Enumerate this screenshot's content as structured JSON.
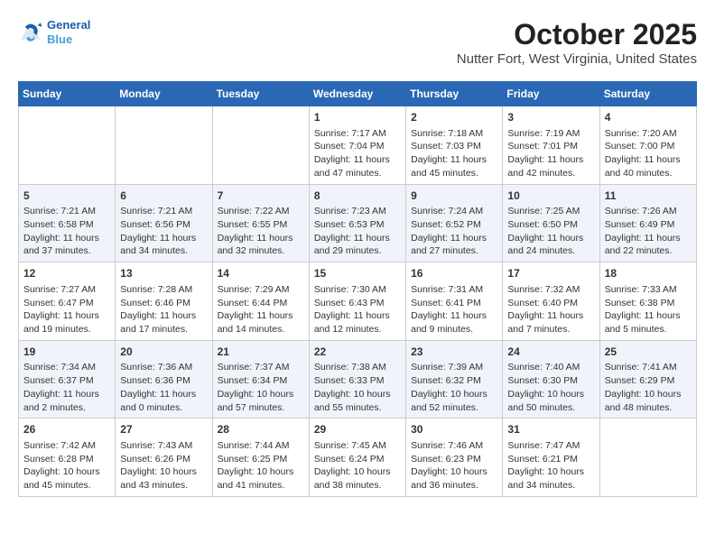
{
  "header": {
    "logo_line1": "General",
    "logo_line2": "Blue",
    "title": "October 2025",
    "subtitle": "Nutter Fort, West Virginia, United States"
  },
  "weekdays": [
    "Sunday",
    "Monday",
    "Tuesday",
    "Wednesday",
    "Thursday",
    "Friday",
    "Saturday"
  ],
  "weeks": [
    [
      {
        "day": "",
        "info": ""
      },
      {
        "day": "",
        "info": ""
      },
      {
        "day": "",
        "info": ""
      },
      {
        "day": "1",
        "info": "Sunrise: 7:17 AM\nSunset: 7:04 PM\nDaylight: 11 hours and 47 minutes."
      },
      {
        "day": "2",
        "info": "Sunrise: 7:18 AM\nSunset: 7:03 PM\nDaylight: 11 hours and 45 minutes."
      },
      {
        "day": "3",
        "info": "Sunrise: 7:19 AM\nSunset: 7:01 PM\nDaylight: 11 hours and 42 minutes."
      },
      {
        "day": "4",
        "info": "Sunrise: 7:20 AM\nSunset: 7:00 PM\nDaylight: 11 hours and 40 minutes."
      }
    ],
    [
      {
        "day": "5",
        "info": "Sunrise: 7:21 AM\nSunset: 6:58 PM\nDaylight: 11 hours and 37 minutes."
      },
      {
        "day": "6",
        "info": "Sunrise: 7:21 AM\nSunset: 6:56 PM\nDaylight: 11 hours and 34 minutes."
      },
      {
        "day": "7",
        "info": "Sunrise: 7:22 AM\nSunset: 6:55 PM\nDaylight: 11 hours and 32 minutes."
      },
      {
        "day": "8",
        "info": "Sunrise: 7:23 AM\nSunset: 6:53 PM\nDaylight: 11 hours and 29 minutes."
      },
      {
        "day": "9",
        "info": "Sunrise: 7:24 AM\nSunset: 6:52 PM\nDaylight: 11 hours and 27 minutes."
      },
      {
        "day": "10",
        "info": "Sunrise: 7:25 AM\nSunset: 6:50 PM\nDaylight: 11 hours and 24 minutes."
      },
      {
        "day": "11",
        "info": "Sunrise: 7:26 AM\nSunset: 6:49 PM\nDaylight: 11 hours and 22 minutes."
      }
    ],
    [
      {
        "day": "12",
        "info": "Sunrise: 7:27 AM\nSunset: 6:47 PM\nDaylight: 11 hours and 19 minutes."
      },
      {
        "day": "13",
        "info": "Sunrise: 7:28 AM\nSunset: 6:46 PM\nDaylight: 11 hours and 17 minutes."
      },
      {
        "day": "14",
        "info": "Sunrise: 7:29 AM\nSunset: 6:44 PM\nDaylight: 11 hours and 14 minutes."
      },
      {
        "day": "15",
        "info": "Sunrise: 7:30 AM\nSunset: 6:43 PM\nDaylight: 11 hours and 12 minutes."
      },
      {
        "day": "16",
        "info": "Sunrise: 7:31 AM\nSunset: 6:41 PM\nDaylight: 11 hours and 9 minutes."
      },
      {
        "day": "17",
        "info": "Sunrise: 7:32 AM\nSunset: 6:40 PM\nDaylight: 11 hours and 7 minutes."
      },
      {
        "day": "18",
        "info": "Sunrise: 7:33 AM\nSunset: 6:38 PM\nDaylight: 11 hours and 5 minutes."
      }
    ],
    [
      {
        "day": "19",
        "info": "Sunrise: 7:34 AM\nSunset: 6:37 PM\nDaylight: 11 hours and 2 minutes."
      },
      {
        "day": "20",
        "info": "Sunrise: 7:36 AM\nSunset: 6:36 PM\nDaylight: 11 hours and 0 minutes."
      },
      {
        "day": "21",
        "info": "Sunrise: 7:37 AM\nSunset: 6:34 PM\nDaylight: 10 hours and 57 minutes."
      },
      {
        "day": "22",
        "info": "Sunrise: 7:38 AM\nSunset: 6:33 PM\nDaylight: 10 hours and 55 minutes."
      },
      {
        "day": "23",
        "info": "Sunrise: 7:39 AM\nSunset: 6:32 PM\nDaylight: 10 hours and 52 minutes."
      },
      {
        "day": "24",
        "info": "Sunrise: 7:40 AM\nSunset: 6:30 PM\nDaylight: 10 hours and 50 minutes."
      },
      {
        "day": "25",
        "info": "Sunrise: 7:41 AM\nSunset: 6:29 PM\nDaylight: 10 hours and 48 minutes."
      }
    ],
    [
      {
        "day": "26",
        "info": "Sunrise: 7:42 AM\nSunset: 6:28 PM\nDaylight: 10 hours and 45 minutes."
      },
      {
        "day": "27",
        "info": "Sunrise: 7:43 AM\nSunset: 6:26 PM\nDaylight: 10 hours and 43 minutes."
      },
      {
        "day": "28",
        "info": "Sunrise: 7:44 AM\nSunset: 6:25 PM\nDaylight: 10 hours and 41 minutes."
      },
      {
        "day": "29",
        "info": "Sunrise: 7:45 AM\nSunset: 6:24 PM\nDaylight: 10 hours and 38 minutes."
      },
      {
        "day": "30",
        "info": "Sunrise: 7:46 AM\nSunset: 6:23 PM\nDaylight: 10 hours and 36 minutes."
      },
      {
        "day": "31",
        "info": "Sunrise: 7:47 AM\nSunset: 6:21 PM\nDaylight: 10 hours and 34 minutes."
      },
      {
        "day": "",
        "info": ""
      }
    ]
  ]
}
